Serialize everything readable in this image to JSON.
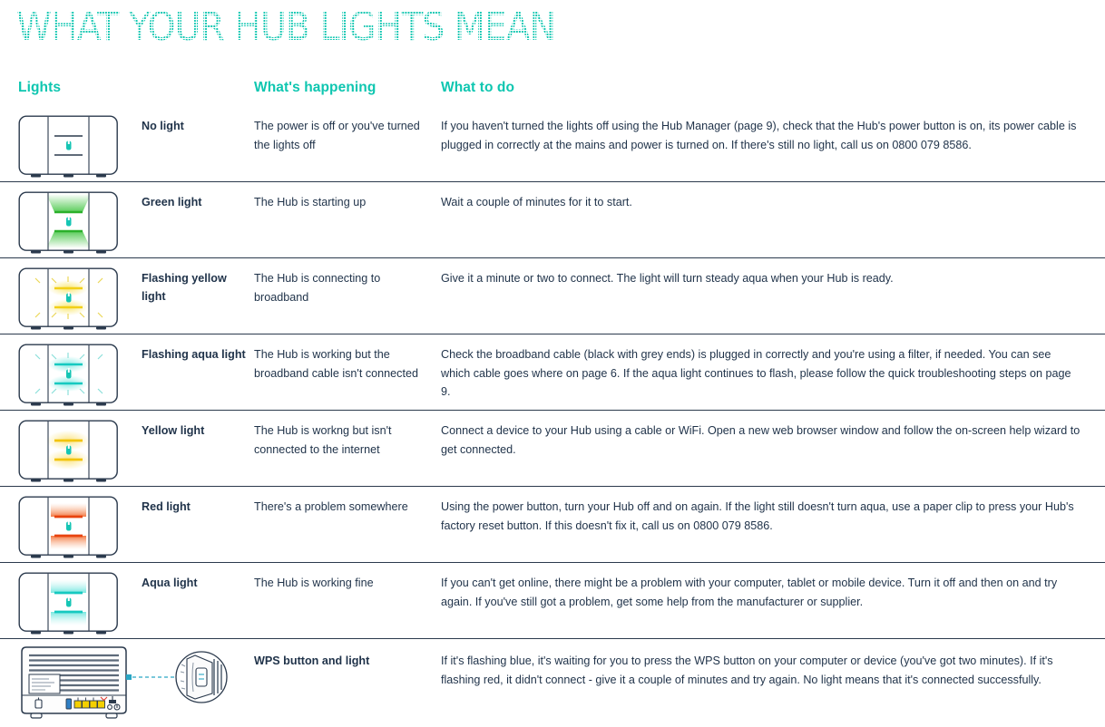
{
  "page": {
    "title": "WHAT YOUR HUB LIGHTS MEAN",
    "accent_color": "#0ec6b0",
    "text_color": "#1f3249",
    "rule_color": "#2b3a4d",
    "background": "#ffffff"
  },
  "headers": {
    "lights": "Lights",
    "happening": "What's happening",
    "todo": "What to do"
  },
  "rows": [
    {
      "icon": "hub-front-no-light",
      "light": "No light",
      "happening": "The power is off or you've turned the lights off",
      "todo": "If you haven't turned the lights off using the Hub Manager (page 9), check that the Hub's power button is on, its power cable is plugged in correctly at the mains and power is turned on. If there's still no light, call us on 0800 079 8586.",
      "light_color": "none",
      "flashing": false
    },
    {
      "icon": "hub-front-green-light",
      "light": "Green light",
      "happening": "The Hub is starting up",
      "todo": "Wait a couple of minutes for it to start.",
      "light_color": "#3dc33d",
      "flashing": false
    },
    {
      "icon": "hub-front-flashing-yellow-light",
      "light": "Flashing yellow light",
      "happening": "The Hub is connecting to broadband",
      "todo": "Give it a minute or two to connect. The light will turn steady aqua when your Hub is ready.",
      "light_color": "#f5d800",
      "flashing": true
    },
    {
      "icon": "hub-front-flashing-aqua-light",
      "light": "Flashing aqua light",
      "happening": "The Hub is working but the broadband cable isn't connected",
      "todo": "Check the broadband cable (black with grey ends) is plugged in correctly and you're using a filter, if needed. You can see which cable goes where on page 6. If the aqua light continues to flash, please follow the quick troubleshooting steps on page 9.",
      "light_color": "#16c9c0",
      "flashing": true
    },
    {
      "icon": "hub-front-yellow-light",
      "light": "Yellow light",
      "happening": "The Hub is workng but isn't connected to the internet",
      "todo": "Connect a device to your Hub using a cable or WiFi. Open a new web browser window and follow the on-screen help wizard to get connected.",
      "light_color": "#f5c400",
      "flashing": false
    },
    {
      "icon": "hub-front-red-light",
      "light": "Red light",
      "happening": "There's a problem somewhere",
      "todo": "Using the power button, turn your Hub off and on again. If the light still doesn't turn aqua, use a paper clip to press your Hub's factory reset button. If this doesn't fix it, call us on 0800 079 8586.",
      "light_color": "#e8430f",
      "flashing": false
    },
    {
      "icon": "hub-front-aqua-light",
      "light": "Aqua light",
      "happening": "The Hub is working fine",
      "todo": "If you can't get online, there might be a problem with your computer, tablet or mobile device. Turn it off and then on and try again. If you've still got a problem, get some help from the manufacturer or supplier.",
      "light_color": "#16c9c0",
      "flashing": false
    },
    {
      "icon": "hub-rear-wps-callout",
      "light": "WPS button and light",
      "happening": "",
      "todo": "If it's flashing blue, it's waiting for you to press the WPS button on your computer or device (you've got two minutes). If it's flashing red, it didn't connect - give it a couple of minutes and try again. No light means that it's connected successfully.",
      "light_color": "none",
      "flashing": false
    }
  ]
}
